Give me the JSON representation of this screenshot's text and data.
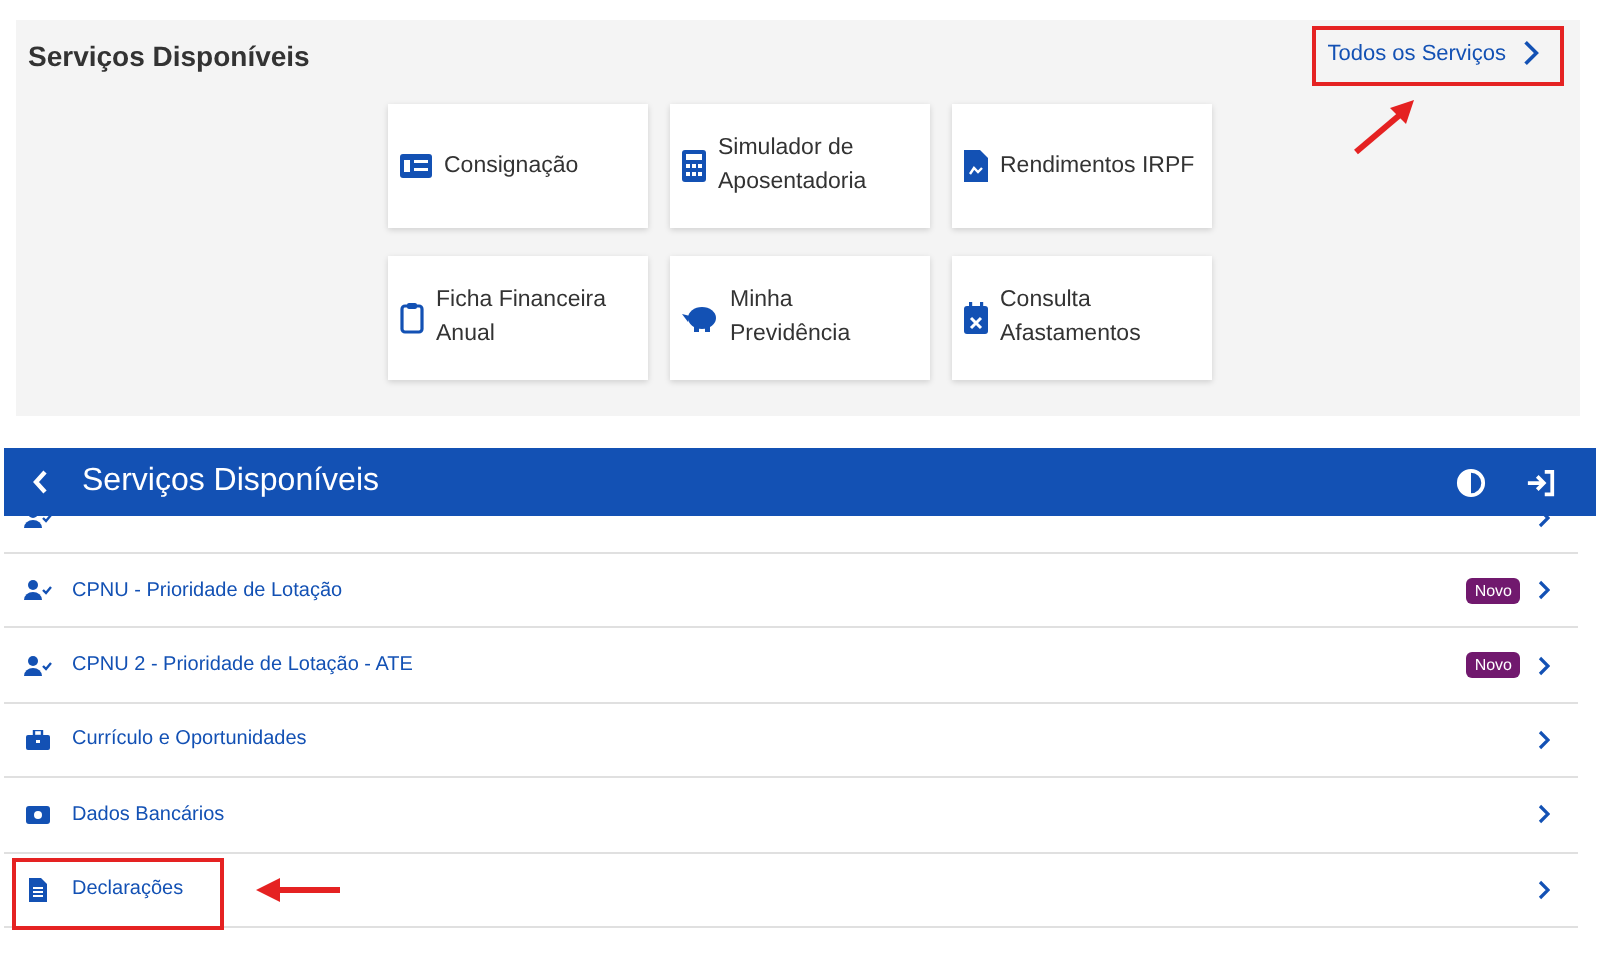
{
  "top": {
    "title": "Serviços Disponíveis",
    "all_link": {
      "label": "Todos os Serviços",
      "highlighted": true
    },
    "cards": [
      {
        "label": "Consignação",
        "kind": "money"
      },
      {
        "label": "Simulador de Aposentadoria",
        "kind": "calculator"
      },
      {
        "label": "Rendimentos IRPF",
        "kind": "document"
      },
      {
        "label": "Ficha Financeira Anual",
        "kind": "clipboard"
      },
      {
        "label": "Minha Previdência",
        "kind": "piggy"
      },
      {
        "label": "Consulta Afastamentos",
        "kind": "calendar"
      }
    ]
  },
  "header": {
    "title": "Serviços Disponíveis"
  },
  "list": {
    "items": [
      {
        "kind": "person",
        "partial": true
      },
      {
        "label": "CPNU - Prioridade de Lotação",
        "kind": "person",
        "badge": "Novo",
        "highlighted": false
      },
      {
        "label": "CPNU 2 - Prioridade de Lotação - ATE",
        "kind": "person",
        "badge": "Novo",
        "highlighted": false
      },
      {
        "label": "Currículo e Oportunidades",
        "kind": "briefcase",
        "highlighted": false
      },
      {
        "label": "Dados Bancários",
        "kind": "money",
        "highlighted": false
      },
      {
        "label": "Declarações",
        "kind": "document",
        "highlighted": true
      }
    ]
  }
}
